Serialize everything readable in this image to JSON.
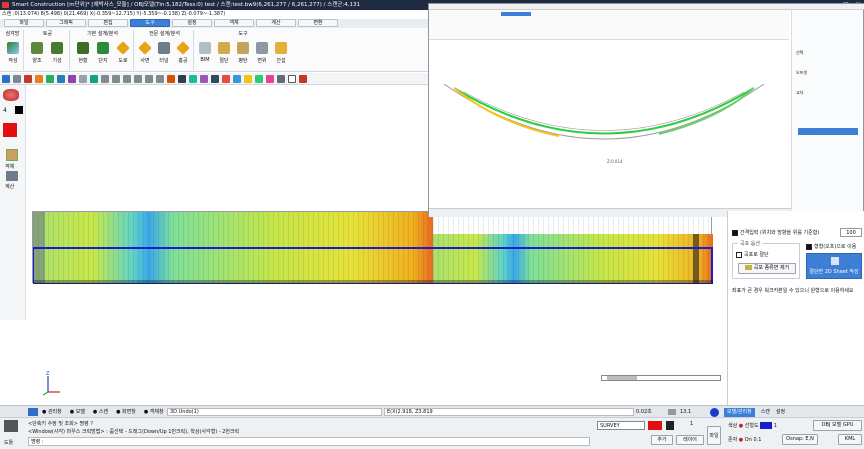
{
  "window": {
    "title": "Smart Construction [m단위]* [예박사스_모듈] / OBJ모델(Tin:5,182/Tess:0) test / 스캔:test.bw9(6,261,277 / 6,261,277) / 스캔군:4,131"
  },
  "coords": "스캔 :0(13.074) 8(5.498) 0(21.469) X(-0.359~12.715) Y(-5.359~-0.138) Z(-0.079~-1.387)",
  "menu": [
    "파일",
    "그래픽",
    "편집",
    "도구",
    "설정",
    "객체",
    "계산",
    "변환"
  ],
  "ribbon": {
    "groups": [
      {
        "title": "삼각망",
        "tools": [
          "작성"
        ]
      },
      {
        "title": "토공",
        "tools": [
          "양조",
          "기성"
        ]
      },
      {
        "title": "기본 설계/분석",
        "tools": [
          "현황",
          "단지",
          "도로"
        ]
      },
      {
        "title": "전문 설계/분석",
        "tools": [
          "사면",
          "터널",
          "홍공"
        ]
      },
      {
        "title": "도구",
        "tools": [
          "BIM",
          "절단",
          "평탄",
          "변위",
          "간섭"
        ]
      }
    ]
  },
  "left_tools": {
    "objects": "객체",
    "calc": "계산",
    "value": "4"
  },
  "right_screenshot": {
    "label": "Z:0.014",
    "panel_labels": [
      "선택",
      "오프셋",
      "교차",
      "단면 설정"
    ]
  },
  "panel": {
    "interval_label": "간격입력 (위치와 방향을 위를 기준함)",
    "interval_value": "100",
    "section_title": "곡포 옵션",
    "cut_label": "곡포로 절단",
    "cut_check_label": "형형(오프)으로 이용",
    "remove_button": "곡포 종류면 제거",
    "apply_button": "절단면 2D Sheet 작성",
    "note": "좌표가 큰 경우 워크카본일 수 있으니 원형으로 이용하세요"
  },
  "statusbar": {
    "mode_tabs": [
      "관리창",
      "모델",
      "스캔",
      "화면창",
      "객체창"
    ],
    "undo_text": "3D Undo(1)",
    "ex_text": "E(X)2.918, Z3.819",
    "scale_text": "0.02초",
    "zoom_value": "13.1",
    "cmd_lines": [
      "<단축키 수정 및 조회> 명령 ?",
      "<Window(사각) 마우스 크릭방법> : 줌선택 - 드래그(Down/Up 1번크릭), 착상(사각형) - 2번크릭"
    ],
    "cmd_prompt": "명령 :",
    "survey_select": "SURVEY",
    "add_button": "추가",
    "layer_button": "레이어",
    "file_button": "파일",
    "dobang": "도툴",
    "right_tabs": [
      "모델/관리창",
      "스캔",
      "설정"
    ],
    "color_label": "색상",
    "line_label": "선형도",
    "line_value": "1",
    "obj_label": "OBJ 모델 GPU",
    "thick_label": "준자",
    "on_label": "On",
    "on_value": "0.1",
    "osnap": "Osnap: E,N",
    "kml": "KML"
  },
  "colors": {
    "accent": "#3d7fd6",
    "titlebar": "#1d2a3f",
    "red": "#e01010",
    "blue_band": "#1a1ad0"
  }
}
